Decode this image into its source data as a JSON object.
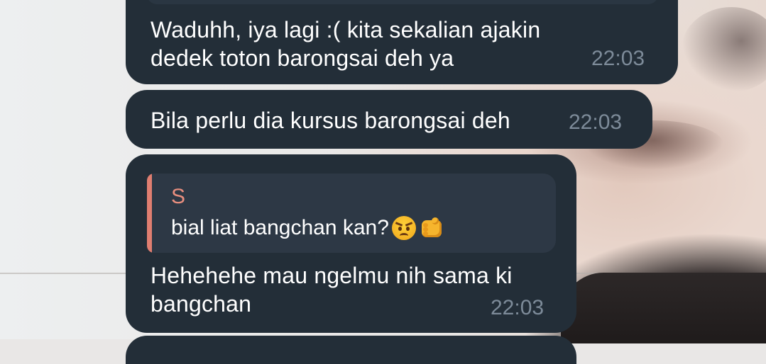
{
  "messages": [
    {
      "text": "Waduhh, iya lagi :( kita sekalian ajakin\ndedek toton barongsai deh ya",
      "time": "22:03"
    },
    {
      "text": "Bila perlu dia kursus barongsai deh",
      "time": "22:03"
    },
    {
      "reply": {
        "sender": "S",
        "quote_text": "bial liat bangchan kan?",
        "emojis": [
          "angry-face-icon",
          "fist-icon"
        ]
      },
      "text": "Hehehehe mau ngelmu nih sama ki\nbangchan",
      "time": "22:03"
    }
  ],
  "colors": {
    "bubble_bg": "#232e38",
    "reply_bg": "#2d3845",
    "reply_accent": "#e07e70",
    "time_text": "#7d8b99",
    "message_text": "#ffffff"
  }
}
